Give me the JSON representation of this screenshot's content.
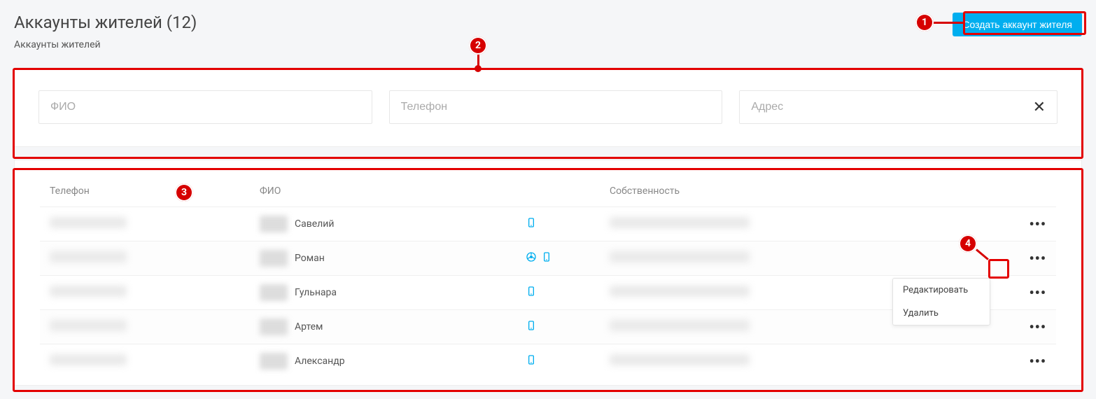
{
  "header": {
    "title": "Аккаунты жителей (12)",
    "subtitle": "Аккаунты жителей",
    "create_button": "Создать аккаунт жителя"
  },
  "filters": {
    "name_placeholder": "ФИО",
    "phone_placeholder": "Телефон",
    "address_placeholder": "Адрес",
    "clear_symbol": "✕"
  },
  "table": {
    "columns": {
      "phone": "Телефон",
      "name": "ФИО",
      "property": "Собственность"
    },
    "rows": [
      {
        "name": "Савелий",
        "icons": [
          "mobile"
        ]
      },
      {
        "name": "Роман",
        "icons": [
          "steering",
          "mobile"
        ]
      },
      {
        "name": "Гульнара",
        "icons": [
          "mobile"
        ]
      },
      {
        "name": "Артем",
        "icons": [
          "mobile"
        ]
      },
      {
        "name": "Александр",
        "icons": [
          "mobile"
        ]
      }
    ]
  },
  "context_menu": {
    "edit": "Редактировать",
    "delete": "Удалить"
  },
  "annotations": {
    "b1": "1",
    "b2": "2",
    "b3": "3",
    "b4": "4"
  },
  "colors": {
    "primary": "#00aeef",
    "annotation": "#d60000"
  }
}
